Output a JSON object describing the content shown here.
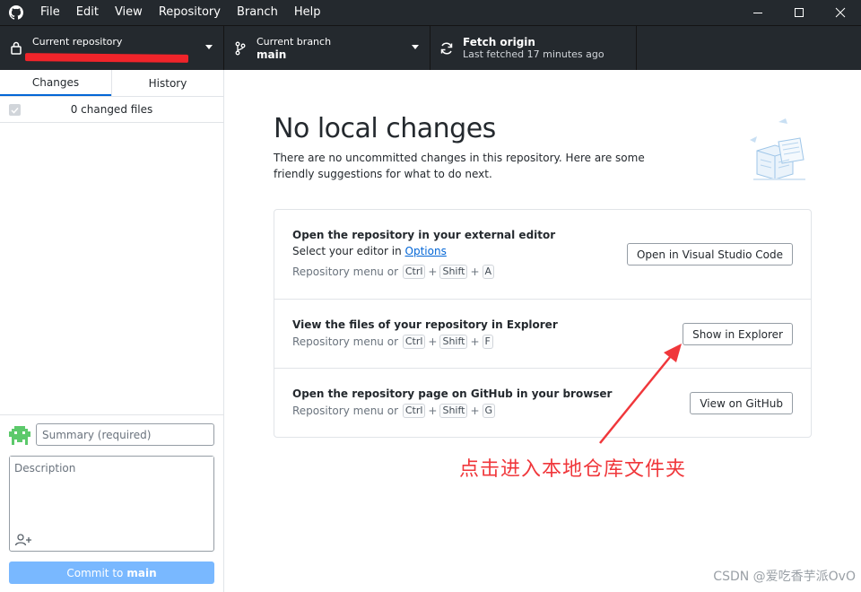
{
  "menu": [
    "File",
    "Edit",
    "View",
    "Repository",
    "Branch",
    "Help"
  ],
  "toolbar": {
    "repo_label": "Current repository",
    "branch_label": "Current branch",
    "branch_value": "main",
    "fetch_label": "Fetch origin",
    "fetch_status": "Last fetched 17 minutes ago"
  },
  "sidebar": {
    "tabs": [
      "Changes",
      "History"
    ],
    "changed_files": "0 changed files",
    "summary_placeholder": "Summary (required)",
    "description_placeholder": "Description",
    "commit_prefix": "Commit to",
    "commit_branch": "main"
  },
  "main": {
    "heading": "No local changes",
    "subtext": "There are no uncommitted changes in this repository. Here are some friendly suggestions for what to do next.",
    "suggestions": [
      {
        "title": "Open the repository in your external editor",
        "line_prefix": "Select your editor in",
        "line_link": "Options",
        "menu_prefix": "Repository menu or",
        "keys": [
          "Ctrl",
          "Shift",
          "A"
        ],
        "button": "Open in Visual Studio Code"
      },
      {
        "title": "View the files of your repository in Explorer",
        "menu_prefix": "Repository menu or",
        "keys": [
          "Ctrl",
          "Shift",
          "F"
        ],
        "button": "Show in Explorer"
      },
      {
        "title": "Open the repository page on GitHub in your browser",
        "menu_prefix": "Repository menu or",
        "keys": [
          "Ctrl",
          "Shift",
          "G"
        ],
        "button": "View on GitHub"
      }
    ]
  },
  "annotation": "点击进入本地仓库文件夹",
  "watermark": "CSDN @爱吃香芋派OvO",
  "colors": {
    "titlebar": "#24292e",
    "accent": "#0366d6",
    "commit_button": "#79b8ff",
    "annotation": "#f0373b"
  },
  "icons": [
    "github-logo-icon",
    "lock-icon",
    "branch-icon",
    "sync-icon",
    "minimize-icon",
    "maximize-icon",
    "close-icon",
    "avatar-icon",
    "add-coauthor-icon"
  ]
}
